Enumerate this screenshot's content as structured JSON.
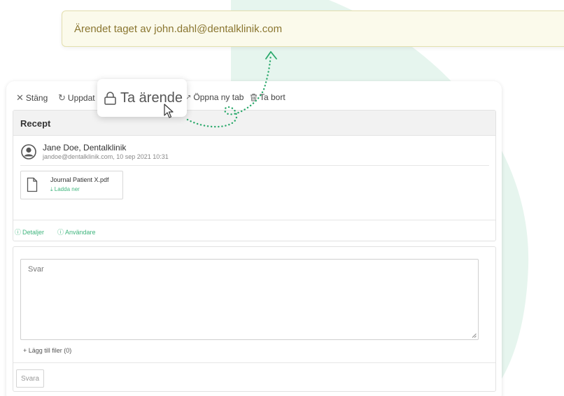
{
  "notification": {
    "text": "Ärendet taget av john.dahl@dentalklinik.com"
  },
  "toolbar": {
    "close_label": "Stäng",
    "update_label": "Uppdat",
    "take_label": "Ta ärende",
    "open_tab_label": "Öppna ny tab",
    "delete_label": "Ta bort"
  },
  "ticket": {
    "title": "Recept",
    "sender_name": "Jane Doe, Dentalklinik",
    "sender_meta": "jandoe@dentalklinik.com, 10 sep 2021 10:31",
    "attachment": {
      "filename": "Journal Patient X.pdf",
      "download_label": "Ladda ner"
    },
    "details_label": "Detaljer",
    "users_label": "Användare"
  },
  "reply": {
    "placeholder": "Svar",
    "add_files_label": "Lägg till filer (0)",
    "send_label": "Svara"
  },
  "colors": {
    "accent_green": "#3fb57d",
    "toast_bg": "#fbfaeb",
    "toast_text": "#8a7630",
    "background_blob": "#e6f5ee"
  },
  "icons": [
    "close-icon",
    "refresh-icon",
    "lock-icon",
    "external-link-icon",
    "trash-icon",
    "avatar-icon",
    "file-icon",
    "download-icon",
    "info-icon",
    "plus-icon",
    "resize-handle-icon",
    "mouse-cursor-icon"
  ]
}
